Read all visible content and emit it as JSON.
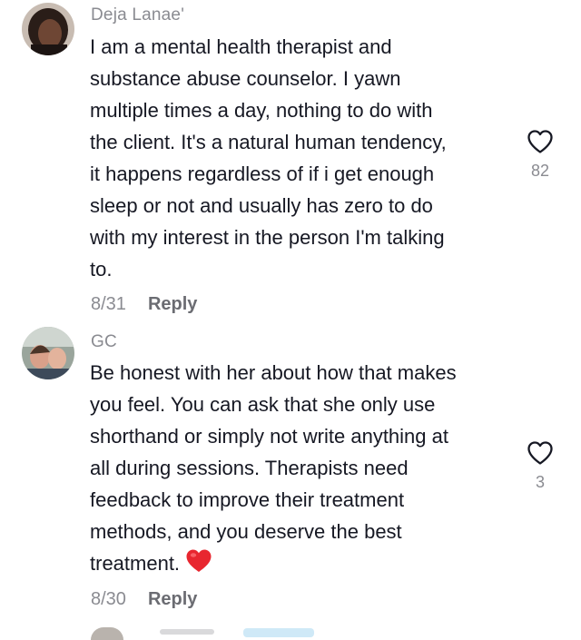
{
  "comments": [
    {
      "username": "Deja Lanae'",
      "text": "I am a mental health therapist and\nsubstance abuse counselor. I yawn\nmultiple times a day, nothing to do with\nthe client. It's a natural human tendency,\nit happens regardless of if i get enough\nsleep or not and usually has zero to do\nwith my interest in the person I'm talking\nto.",
      "date": "8/31",
      "reply_label": "Reply",
      "like_count": "82",
      "like_icon": "heart-outline-icon"
    },
    {
      "username": "GC",
      "text": "Be honest with her about how that makes\nyou feel. You can ask that she only use\nshorthand or simply not write anything at\nall during sessions. Therapists need\nfeedback to improve their treatment\nmethods, and you deserve the best\ntreatment.",
      "emoji": "red-heart-emoji",
      "date": "8/30",
      "reply_label": "Reply",
      "like_count": "3",
      "like_icon": "heart-outline-icon"
    }
  ],
  "colors": {
    "text": "#161823",
    "secondary_text": "#8a8b91",
    "reply": "#6b6c72",
    "heart_emoji": "#e8262f"
  }
}
